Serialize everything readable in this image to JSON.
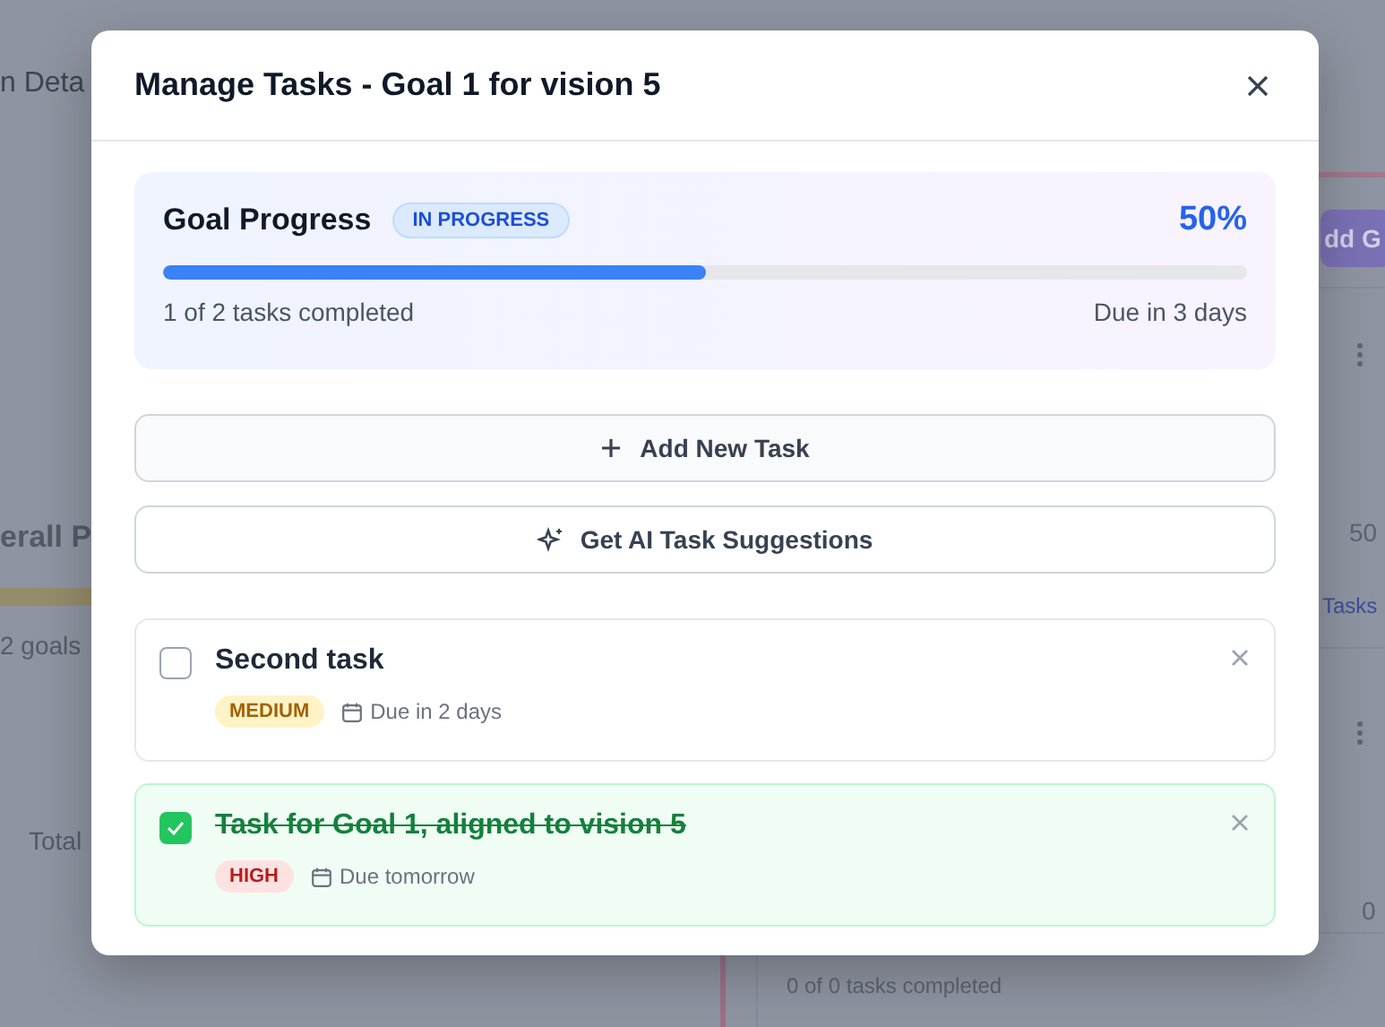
{
  "background": {
    "page_title": "n Deta",
    "overall_title": "erall P",
    "goals_summary": "2 goals",
    "stat_label": "Total",
    "add_goal_button": "dd G",
    "goal_percent_1": "50",
    "tasks_link": "Tasks",
    "goal_percent_2": "0",
    "goal_tasks_summary": "0 of 0 tasks completed"
  },
  "modal": {
    "title": "Manage Tasks - Goal 1 for vision 5",
    "progress": {
      "label": "Goal Progress",
      "status": "IN PROGRESS",
      "percent": "50%",
      "level": 0.5,
      "summary": "1 of 2 tasks completed",
      "due": "Due in 3 days"
    },
    "actions": [
      {
        "kind": "add",
        "label": "Add New Task"
      },
      {
        "kind": "ai",
        "label": "Get AI Task Suggestions"
      }
    ],
    "tasks": [
      {
        "title": "Second task",
        "checked": false,
        "kind": "medium",
        "priority_label": "MEDIUM",
        "due": "Due in 2 days"
      },
      {
        "title": "Task for Goal 1, aligned to vision 5",
        "checked": true,
        "kind": "high",
        "priority_label": "HIGH",
        "due": "Due tomorrow"
      }
    ]
  }
}
